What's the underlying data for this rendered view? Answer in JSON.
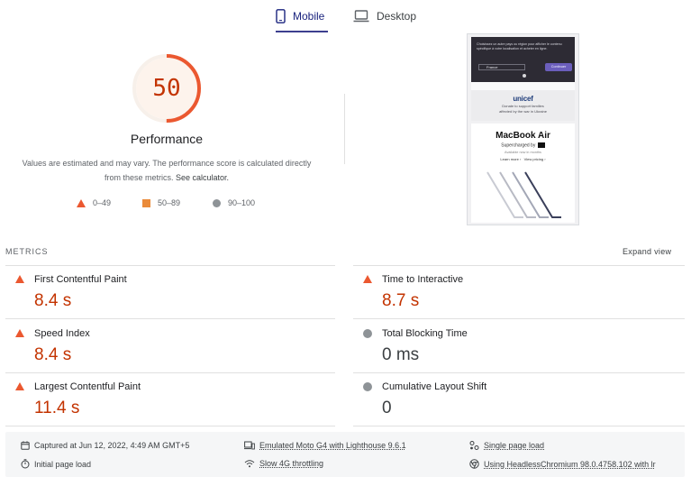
{
  "tabs": {
    "mobile": "Mobile",
    "desktop": "Desktop"
  },
  "score": {
    "value": "50",
    "fraction": 0.5,
    "label": "Performance",
    "color": "#eb5830"
  },
  "description": {
    "text": "Values are estimated and may vary. The performance score is calculated directly from these metrics.",
    "link": "See calculator."
  },
  "legend": {
    "fail": "0–49",
    "average": "50–89",
    "pass": "90–100"
  },
  "phone": {
    "banner_text": "Choisissez un autre pays ou région pour afficher le contenu spécifique à votre localisation et acheter en ligne.",
    "select_value": "France",
    "button": "Continuer",
    "unicef_logo": "unicef",
    "unicef_line1": "Donate to support families",
    "unicef_line2": "affected by the war in Ukraine",
    "product_title": "MacBook Air",
    "product_sub": "Supercharged by",
    "product_small": "Available now in months",
    "link_learn": "Learn more ›",
    "link_pricing": "View pricing ›"
  },
  "metrics": {
    "heading": "METRICS",
    "expand": "Expand view",
    "fcp": {
      "name": "First Contentful Paint",
      "value": "8.4 s"
    },
    "tti": {
      "name": "Time to Interactive",
      "value": "8.7 s"
    },
    "si": {
      "name": "Speed Index",
      "value": "8.4 s"
    },
    "tbt": {
      "name": "Total Blocking Time",
      "value": "0 ms"
    },
    "lcp": {
      "name": "Largest Contentful Paint",
      "value": "11.4 s"
    },
    "cls": {
      "name": "Cumulative Layout Shift",
      "value": "0"
    }
  },
  "footer": {
    "captured": "Captured at Jun 12, 2022, 4:49 AM GMT+5",
    "initial": "Initial page load",
    "emulated": "Emulated Moto G4 with Lighthouse 9.6.1",
    "throttling": "Slow 4G throttling",
    "single": "Single page load",
    "browser": "Using HeadlessChromium 98.0.4758.102 with lr"
  }
}
